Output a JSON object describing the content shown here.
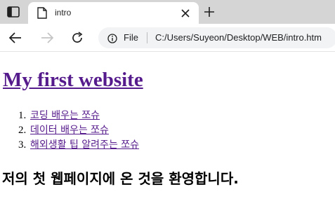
{
  "browser": {
    "tab": {
      "title": "intro"
    },
    "toolbar": {
      "site_info_label": "File",
      "url": "C:/Users/Suyeon/Desktop/WEB/intro.htm"
    },
    "icons": [
      "tab-actions-icon",
      "file-favicon",
      "close-icon",
      "plus-icon",
      "back-arrow-icon",
      "forward-arrow-icon",
      "reload-icon",
      "info-icon"
    ]
  },
  "page": {
    "heading": "My first website",
    "links": [
      {
        "number": "1.",
        "text": "코딩 배우는 쪼슈"
      },
      {
        "number": "2.",
        "text": "데이터 배우는 쪼슈"
      },
      {
        "number": "3.",
        "text": "해외생활 팁 알려주는 쪼슈"
      }
    ],
    "welcome": "저의 첫 웹페이지에 온 것을 환영합니다."
  },
  "colors": {
    "visited_link": "#551a8b",
    "tab_strip": "#d5d5d5",
    "omnibox": "#f1f3f4"
  }
}
